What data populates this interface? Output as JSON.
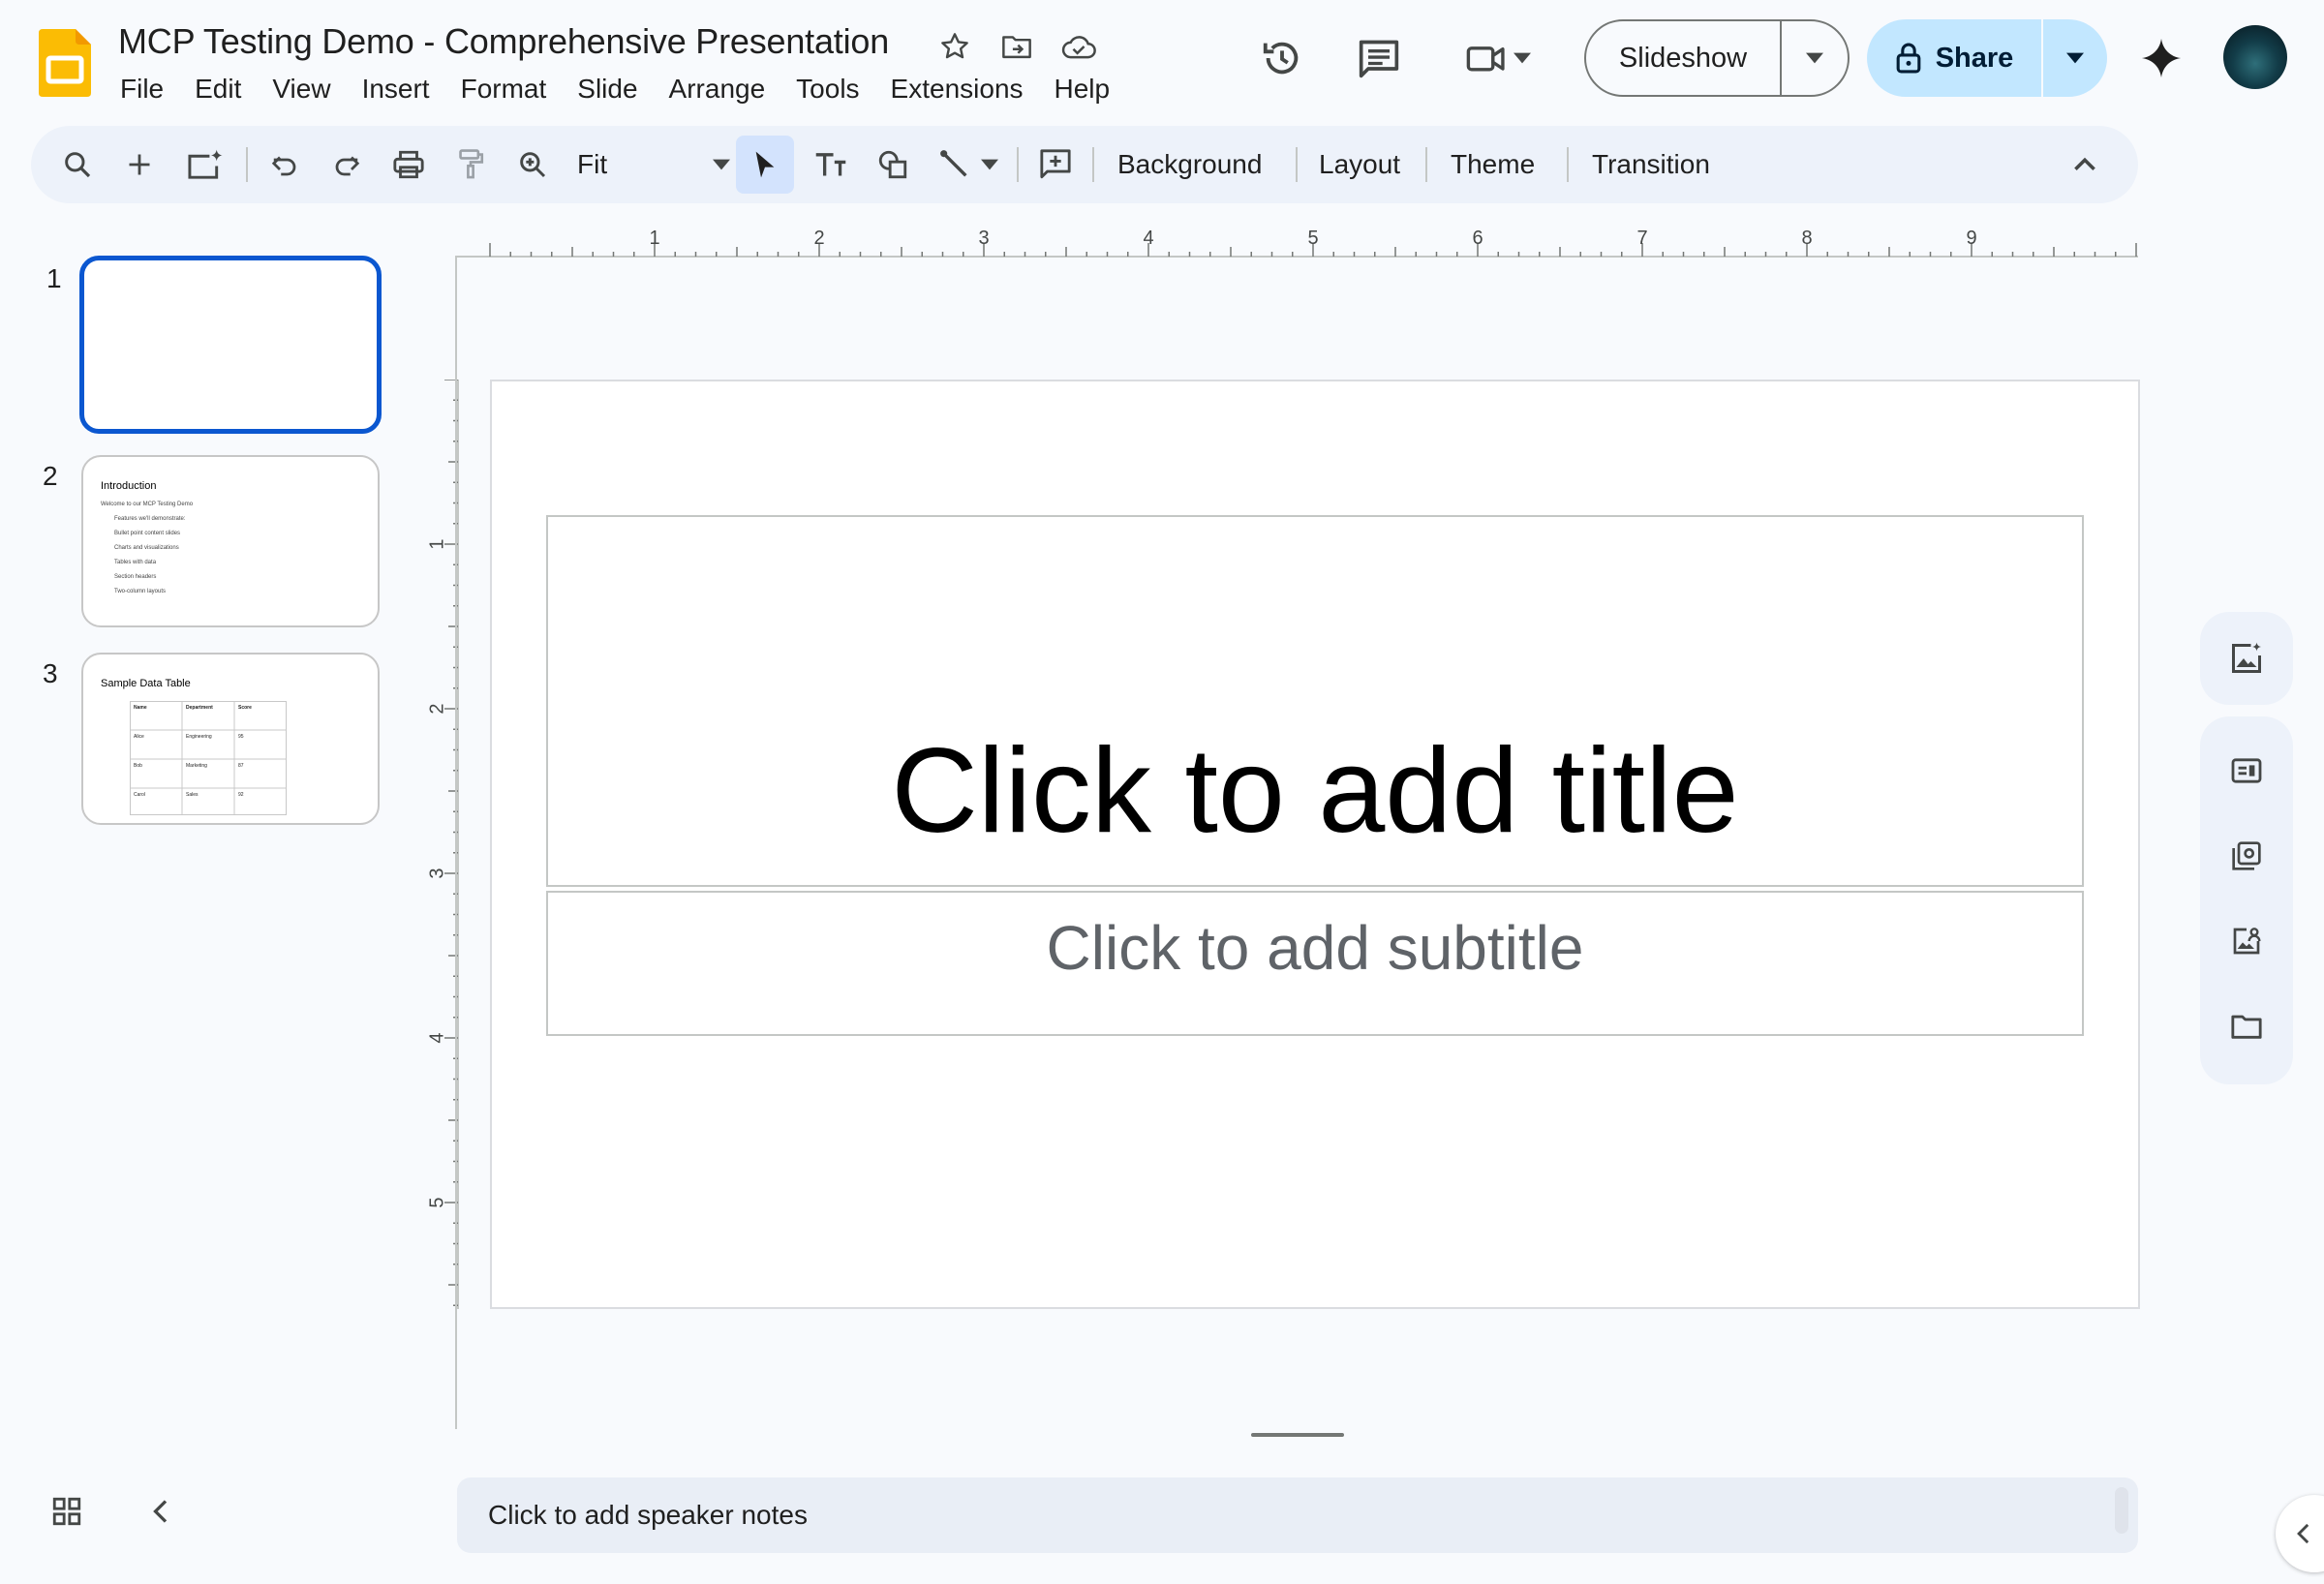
{
  "doc": {
    "title": "MCP Testing Demo - Comprehensive Presentation"
  },
  "menu": [
    "File",
    "Edit",
    "View",
    "Insert",
    "Format",
    "Slide",
    "Arrange",
    "Tools",
    "Extensions",
    "Help"
  ],
  "header": {
    "slideshow_label": "Slideshow",
    "share_label": "Share"
  },
  "toolbar": {
    "zoom": "Fit",
    "background": "Background",
    "layout": "Layout",
    "theme": "Theme",
    "transition": "Transition"
  },
  "slides": [
    {
      "number": "1"
    },
    {
      "number": "2",
      "title": "Introduction",
      "intro": "Welcome to our MCP Testing Demo",
      "sub_intro": "Features we'll demonstrate:",
      "bullets": [
        "Bullet point content slides",
        "Charts and visualizations",
        "Tables with data",
        "Section headers",
        "Two-column layouts"
      ]
    },
    {
      "number": "3",
      "title": "Sample Data Table",
      "table": {
        "headers": [
          "Name",
          "Department",
          "Score"
        ],
        "rows": [
          [
            "Alice",
            "Engineering",
            "95"
          ],
          [
            "Bob",
            "Marketing",
            "87"
          ],
          [
            "Carol",
            "Sales",
            "92"
          ]
        ]
      }
    }
  ],
  "ruler": {
    "h_labels": [
      "1",
      "2",
      "3",
      "4",
      "5",
      "6",
      "7",
      "8",
      "9"
    ],
    "v_labels": [
      "1",
      "2",
      "3",
      "4",
      "5"
    ]
  },
  "canvas": {
    "title_placeholder": "Click to add title",
    "subtitle_placeholder": "Click to add subtitle"
  },
  "notes": {
    "placeholder": "Click to add speaker notes"
  },
  "colors": {
    "accent": "#0b57d0",
    "share_bg": "#c2e7ff",
    "toolbar_bg": "#edf2fa",
    "logo": "#fbbc04"
  }
}
